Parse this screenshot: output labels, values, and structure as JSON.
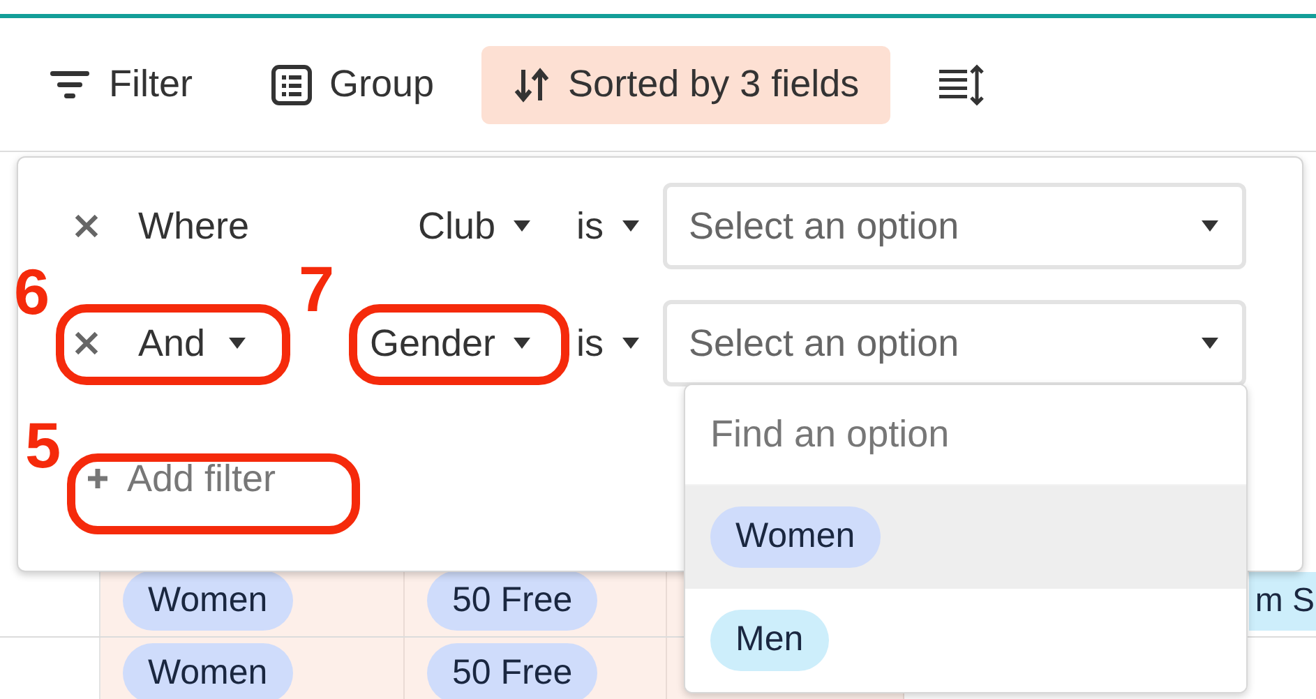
{
  "toolbar": [
    {
      "kind": "filter",
      "label": "Filter",
      "active": false
    },
    {
      "kind": "group",
      "label": "Group",
      "active": false
    },
    {
      "kind": "sort",
      "label": "Sorted by 3 fields",
      "active": true
    },
    {
      "kind": "rowheight"
    }
  ],
  "filter_panel": {
    "conditions": [
      {
        "conjunction": "Where",
        "kind": "label",
        "field": "Club",
        "operator": "is",
        "value_placeholder": "Select an option"
      },
      {
        "conjunction": "And",
        "kind": "dropdown",
        "field": "Gender",
        "operator": "is",
        "value_placeholder": "Select an option"
      }
    ],
    "add_filter": "Add filter"
  },
  "option_dropdown": {
    "search_placeholder": "Find an option",
    "options": [
      {
        "label": "Women",
        "color": "#cfdcfb",
        "selected": true
      },
      {
        "label": "Men",
        "color": "#cdeefb",
        "selected": false
      }
    ]
  },
  "table_rows": [
    {
      "gender": "Women",
      "event": "50 Free",
      "column_3": "m S"
    },
    {
      "gender": "Women",
      "event": "50 Free"
    }
  ],
  "annotations": [
    {
      "label": "6"
    },
    {
      "label": "7"
    },
    {
      "label": "5"
    }
  ]
}
